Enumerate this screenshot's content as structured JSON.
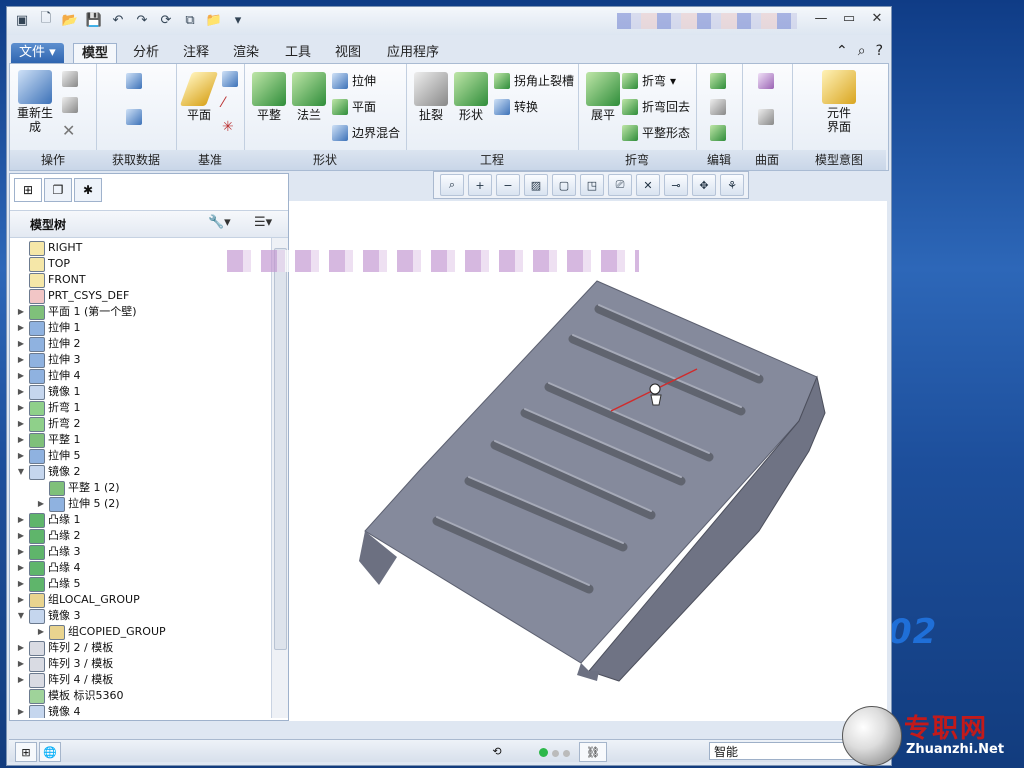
{
  "watermark": {
    "cn": "专职网",
    "en": "Zhuanzhi.Net"
  },
  "desktop": {
    "text": "02"
  },
  "menu": {
    "tabs": [
      "文件",
      "模型",
      "分析",
      "注释",
      "渲染",
      "工具",
      "视图",
      "应用程序"
    ],
    "active": "模型"
  },
  "ribbon": {
    "groups": [
      "操作",
      "获取数据",
      "基准",
      "形状",
      "工程",
      "折弯",
      "编辑",
      "曲面",
      "模型意图"
    ],
    "regen": "重新生成",
    "plane": "平面",
    "flat": "平整",
    "flange": "法兰",
    "extrude": "拉伸",
    "plane_small": "平面",
    "boundary_blend": "边界混合",
    "rip": "扯裂",
    "form": "形状",
    "corner_relief": "拐角止裂槽",
    "convert": "转换",
    "unbend": "展平",
    "bend": "折弯",
    "bend_back": "折弯回去",
    "flatten": "平整形态",
    "component_interface_1": "元件",
    "component_interface_2": "界面"
  },
  "panel": {
    "title": "模型树"
  },
  "tree": [
    {
      "label": "RIGHT",
      "indent": 0,
      "exp": "",
      "icon": "datum-plane-icon"
    },
    {
      "label": "TOP",
      "indent": 0,
      "exp": "",
      "icon": "datum-plane-icon"
    },
    {
      "label": "FRONT",
      "indent": 0,
      "exp": "",
      "icon": "datum-plane-icon"
    },
    {
      "label": "PRT_CSYS_DEF",
      "indent": 0,
      "exp": "",
      "icon": "csys-icon"
    },
    {
      "label": "平面 1 (第一个壁)",
      "indent": 0,
      "exp": "▶",
      "icon": "flat-wall-icon"
    },
    {
      "label": "拉伸 1",
      "indent": 0,
      "exp": "▶",
      "icon": "extrude-icon"
    },
    {
      "label": "拉伸 2",
      "indent": 0,
      "exp": "▶",
      "icon": "extrude-icon"
    },
    {
      "label": "拉伸 3",
      "indent": 0,
      "exp": "▶",
      "icon": "extrude-icon"
    },
    {
      "label": "拉伸 4",
      "indent": 0,
      "exp": "▶",
      "icon": "extrude-icon"
    },
    {
      "label": "镜像 1",
      "indent": 0,
      "exp": "▶",
      "icon": "mirror-icon"
    },
    {
      "label": "折弯 1",
      "indent": 0,
      "exp": "▶",
      "icon": "bend-icon"
    },
    {
      "label": "折弯 2",
      "indent": 0,
      "exp": "▶",
      "icon": "bend-icon"
    },
    {
      "label": "平整 1",
      "indent": 0,
      "exp": "▶",
      "icon": "flat-icon"
    },
    {
      "label": "拉伸 5",
      "indent": 0,
      "exp": "▶",
      "icon": "extrude-icon"
    },
    {
      "label": "镜像 2",
      "indent": 0,
      "exp": "▼",
      "icon": "mirror-icon"
    },
    {
      "label": "平整 1 (2)",
      "indent": 1,
      "exp": "",
      "icon": "flat-icon"
    },
    {
      "label": "拉伸 5 (2)",
      "indent": 1,
      "exp": "▶",
      "icon": "extrude-icon"
    },
    {
      "label": "凸缘 1",
      "indent": 0,
      "exp": "▶",
      "icon": "flange-icon"
    },
    {
      "label": "凸缘 2",
      "indent": 0,
      "exp": "▶",
      "icon": "flange-icon"
    },
    {
      "label": "凸缘 3",
      "indent": 0,
      "exp": "▶",
      "icon": "flange-icon"
    },
    {
      "label": "凸缘 4",
      "indent": 0,
      "exp": "▶",
      "icon": "flange-icon"
    },
    {
      "label": "凸缘 5",
      "indent": 0,
      "exp": "▶",
      "icon": "flange-icon"
    },
    {
      "label": "组LOCAL_GROUP",
      "indent": 0,
      "exp": "▶",
      "icon": "group-icon"
    },
    {
      "label": "镜像 3",
      "indent": 0,
      "exp": "▼",
      "icon": "mirror-icon"
    },
    {
      "label": "组COPIED_GROUP",
      "indent": 1,
      "exp": "▶",
      "icon": "group-icon"
    },
    {
      "label": "阵列 2 / 模板",
      "indent": 0,
      "exp": "▶",
      "icon": "pattern-icon"
    },
    {
      "label": "阵列 3 / 模板",
      "indent": 0,
      "exp": "▶",
      "icon": "pattern-icon"
    },
    {
      "label": "阵列 4 / 模板",
      "indent": 0,
      "exp": "▶",
      "icon": "pattern-icon"
    },
    {
      "label": "模板 标识5360",
      "indent": 0,
      "exp": "",
      "icon": "template-icon"
    },
    {
      "label": "镜像 4",
      "indent": 0,
      "exp": "▶",
      "icon": "mirror-icon"
    }
  ],
  "status": {
    "filter": "智能"
  },
  "colors": {
    "part": "#7b7f91",
    "part_top": "#9498a8",
    "accent": "#2f65b0"
  }
}
